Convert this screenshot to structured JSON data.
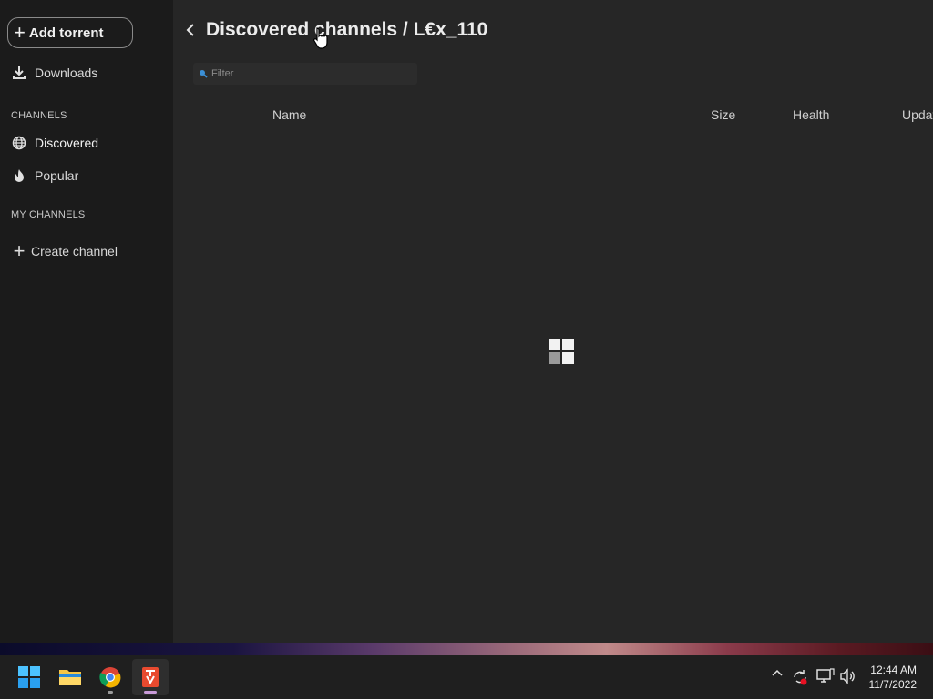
{
  "sidebar": {
    "add_torrent_label": "Add torrent",
    "downloads_label": "Downloads",
    "channels_heading": "CHANNELS",
    "discovered_label": "Discovered",
    "popular_label": "Popular",
    "my_channels_heading": "MY CHANNELS",
    "create_channel_label": "Create channel"
  },
  "header": {
    "title": "Discovered channels / L€x_110"
  },
  "filter": {
    "placeholder": "Filter"
  },
  "table": {
    "columns": [
      "Name",
      "Size",
      "Health",
      "Updated"
    ]
  },
  "taskbar": {
    "apps": [
      "windows-start-icon",
      "file-explorer-icon",
      "chrome-icon",
      "tribler-icon"
    ],
    "time": "12:44 AM",
    "date": "11/7/2022"
  },
  "colors": {
    "background": "#262626",
    "sidebar": "#1b1b1b",
    "taskbar": "#1f1f1f",
    "text": "#e6e6e6"
  }
}
